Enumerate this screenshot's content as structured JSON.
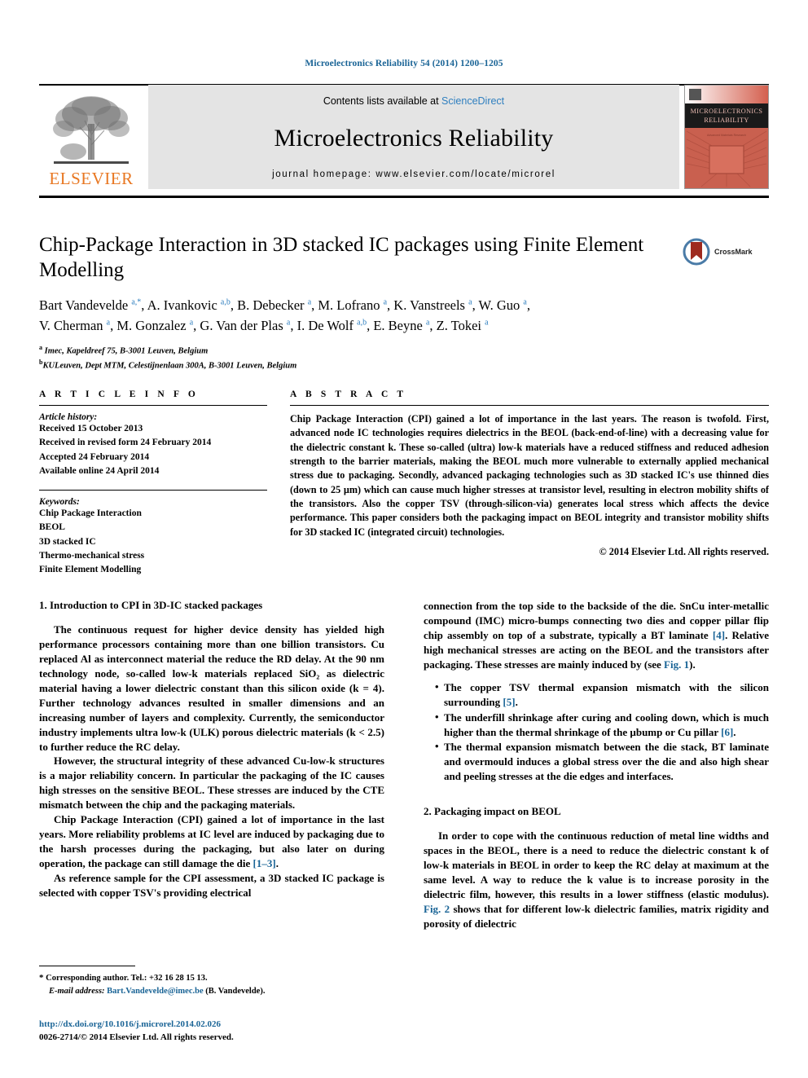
{
  "running_head": "Microelectronics Reliability 54 (2014) 1200–1205",
  "masthead": {
    "contents_prefix": "Contents lists available at ",
    "sciencedirect": "ScienceDirect",
    "journal_title": "Microelectronics Reliability",
    "homepage": "journal homepage: www.elsevier.com/locate/microrel",
    "publisher_wordmark": "ELSEVIER",
    "cover_title_line1": "MICROELECTRONICS",
    "cover_title_line2": "RELIABILITY",
    "accent_orange": "#E87722",
    "link_blue": "#2f7fbf",
    "cover_red": "#c0504d"
  },
  "article": {
    "title": "Chip-Package Interaction in 3D stacked IC packages using Finite Element Modelling",
    "crossmark_label": "CrossMark",
    "authors_line1": "Bart Vandevelde <sup>a,*</sup>, A. Ivankovic <sup>a,b</sup>, B. Debecker <sup>a</sup>, M. Lofrano <sup>a</sup>, K. Vanstreels <sup>a</sup>, W. Guo <sup>a</sup>,",
    "authors_line2": "V. Cherman <sup>a</sup>, M. Gonzalez <sup>a</sup>, G. Van der Plas <sup>a</sup>, I. De Wolf <sup>a,b</sup>, E. Beyne <sup>a</sup>, Z. Tokei <sup>a</sup>",
    "affiliation_a": "Imec, Kapeldreef 75, B-3001 Leuven, Belgium",
    "affiliation_b": "KULeuven, Dept MTM, Celestijnenlaan 300A, B-3001 Leuven, Belgium"
  },
  "info": {
    "heading": "A R T I C L E    I N F O",
    "history_title": "Article history:",
    "history": [
      "Received 15 October 2013",
      "Received in revised form 24 February 2014",
      "Accepted 24 February 2014",
      "Available online 24 April 2014"
    ],
    "keywords_title": "Keywords:",
    "keywords": [
      "Chip Package Interaction",
      "BEOL",
      "3D stacked IC",
      "Thermo-mechanical stress",
      "Finite Element Modelling"
    ]
  },
  "abstract": {
    "heading": "A B S T R A C T",
    "text": "Chip Package Interaction (CPI) gained a lot of importance in the last years. The reason is twofold. First, advanced node IC technologies requires dielectrics in the BEOL (back-end-of-line) with a decreasing value for the dielectric constant k. These so-called (ultra) low-k materials have a reduced stiffness and reduced adhesion strength to the barrier materials, making the BEOL much more vulnerable to externally applied mechanical stress due to packaging. Secondly, advanced packaging technologies such as 3D stacked IC's use thinned dies (down to 25 µm) which can cause much higher stresses at transistor level, resulting in electron mobility shifts of the transistors. Also the copper TSV (through-silicon-via) generates local stress which affects the device performance. This paper considers both the packaging impact on BEOL integrity and transistor mobility shifts for 3D stacked IC (integrated circuit) technologies.",
    "copyright": "© 2014 Elsevier Ltd. All rights reserved."
  },
  "body": {
    "section1_heading": "1. Introduction to CPI in 3D-IC stacked packages",
    "section1_p1": "The continuous request for higher device density has yielded high performance processors containing more than one billion transistors. Cu replaced Al as interconnect material the reduce the RD delay. At the 90 nm technology node, so-called low-k materials replaced SiO₂ as dielectric material having a lower dielectric constant than this silicon oxide (k = 4). Further technology advances resulted in smaller dimensions and an increasing number of layers and complexity. Currently, the semiconductor industry implements ultra low-k (ULK) porous dielectric materials (k < 2.5) to further reduce the RC delay.",
    "section1_p2": "However, the structural integrity of these advanced Cu-low-k structures is a major reliability concern. In particular the packaging of the IC causes high stresses on the sensitive BEOL. These stresses are induced by the CTE mismatch between the chip and the packaging materials.",
    "section1_p3_a": "Chip Package Interaction (CPI) gained a lot of importance in the last years. More reliability problems at IC level are induced by packaging due to the harsh processes during the packaging, but also later on during operation, the package can still damage the die ",
    "section1_p3_ref": "[1–3]",
    "section1_p3_b": ".",
    "section1_p4": "As reference sample for the CPI assessment, a 3D stacked IC package is selected with copper TSV's providing electrical",
    "right_p1_a": "connection from the top side to the backside of the die. SnCu inter-metallic compound (IMC) micro-bumps connecting two dies and copper pillar flip chip assembly on top of a substrate, typically a BT laminate ",
    "right_p1_ref1": "[4]",
    "right_p1_b": ". Relative high mechanical stresses are acting on the BEOL and the transistors after packaging. These stresses are mainly induced by (see ",
    "right_p1_ref2": "Fig. 1",
    "right_p1_c": ").",
    "bullets": [
      {
        "text_a": "The copper TSV thermal expansion mismatch with the silicon surrounding ",
        "ref": "[5]",
        "text_b": "."
      },
      {
        "text_a": "The underfill shrinkage after curing and cooling down, which is much higher than the thermal shrinkage of the µbump or Cu pillar ",
        "ref": "[6]",
        "text_b": "."
      },
      {
        "text_a": "The thermal expansion mismatch between the die stack, BT laminate and overmould induces a global stress over the die and also high shear and peeling stresses at the die edges and interfaces.",
        "ref": "",
        "text_b": ""
      }
    ],
    "section2_heading": "2. Packaging impact on BEOL",
    "section2_p1_a": "In order to cope with the continuous reduction of metal line widths and spaces in the BEOL, there is a need to reduce the dielectric constant k of low-k materials in BEOL in order to keep the RC delay at maximum at the same level. A way to reduce the k value is to increase porosity in the dielectric film, however, this results in a lower stiffness (elastic modulus). ",
    "section2_p1_ref": "Fig. 2",
    "section2_p1_b": " shows that for different low-k dielectric families, matrix rigidity and porosity of dielectric"
  },
  "footnote": {
    "star": "*",
    "corresponding": " Corresponding author. Tel.: +32 16 28 15 13.",
    "email_label": "E-mail address:",
    "email": "Bart.Vandevelde@imec.be",
    "email_suffix": " (B. Vandevelde)."
  },
  "footer": {
    "doi": "http://dx.doi.org/10.1016/j.microrel.2014.02.026",
    "issn": "0026-2714/© 2014 Elsevier Ltd. All rights reserved."
  }
}
